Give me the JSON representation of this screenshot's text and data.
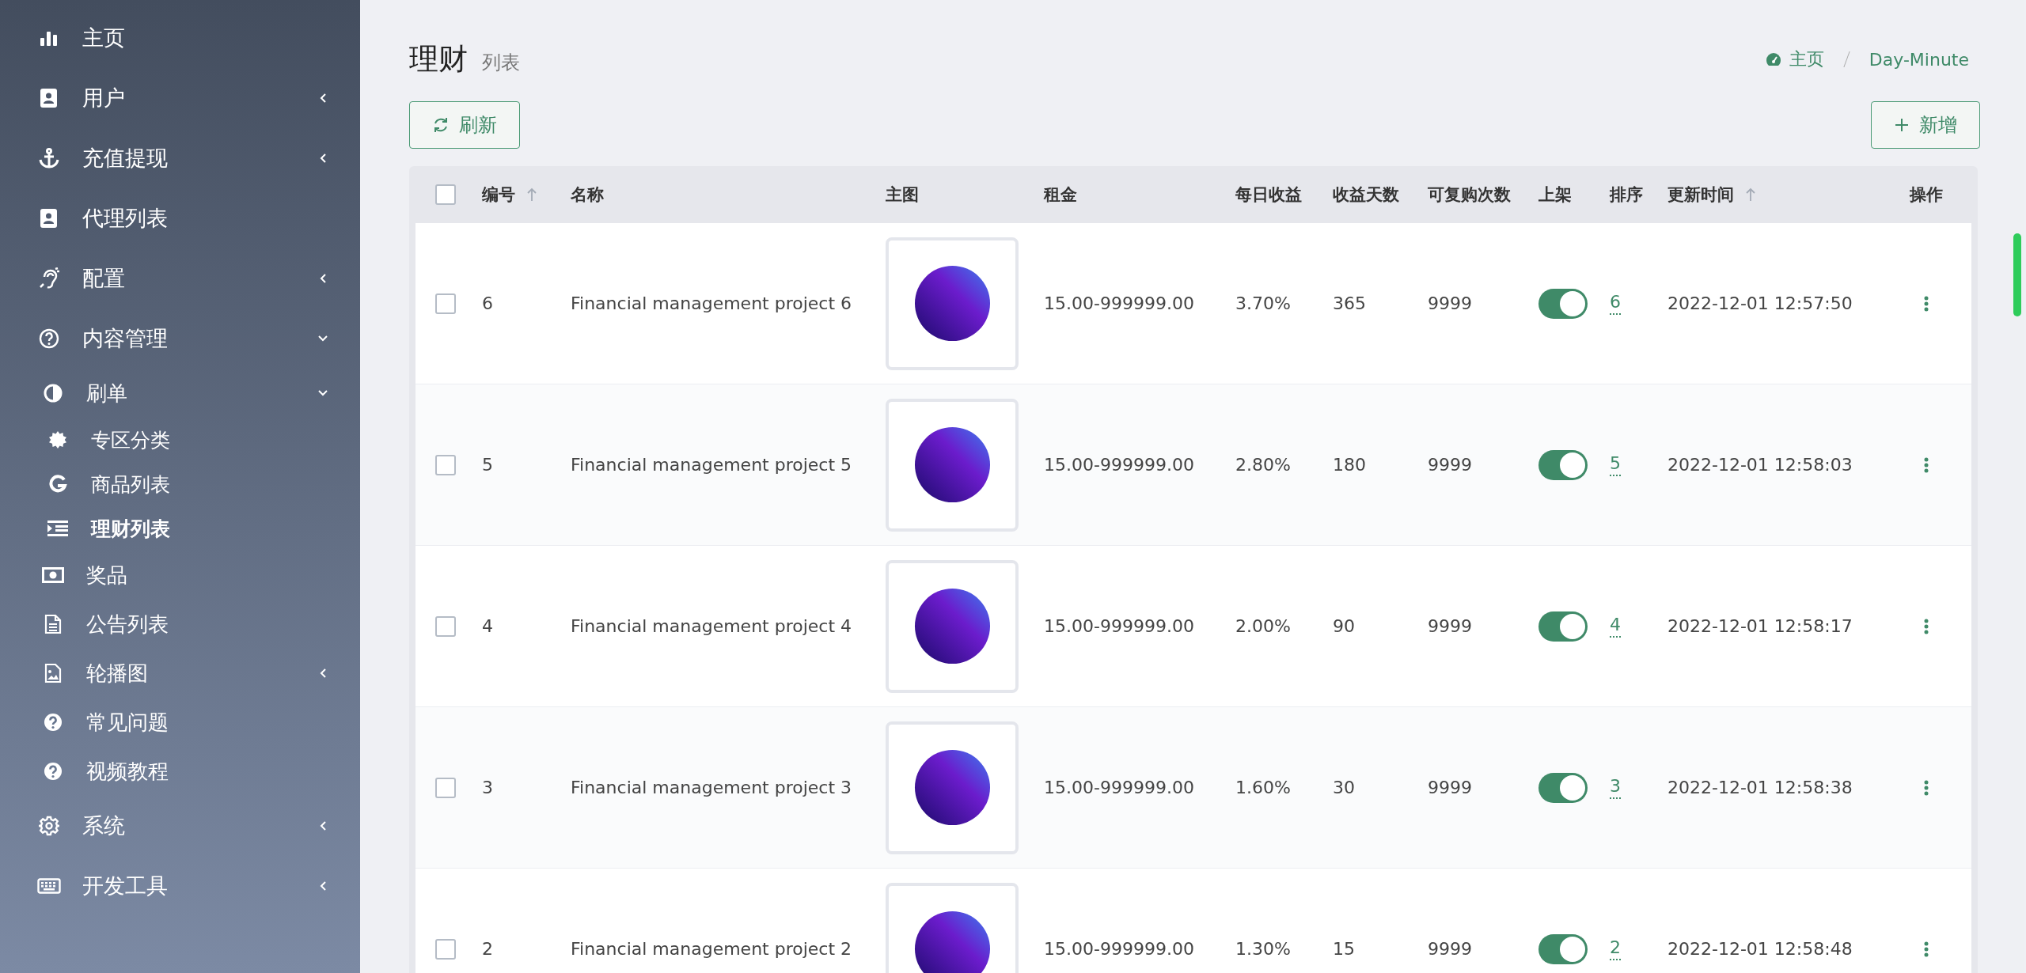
{
  "sidebar": {
    "items": [
      {
        "label": "主页",
        "selected": false
      },
      {
        "label": "用户",
        "selected": false,
        "expanded": false
      },
      {
        "label": "充值提现",
        "selected": false,
        "expanded": false
      },
      {
        "label": "代理列表",
        "selected": false
      },
      {
        "label": "配置",
        "selected": false,
        "expanded": false
      },
      {
        "label": "内容管理",
        "selected": false,
        "expanded": true,
        "children": [
          {
            "label": "刷单",
            "selected": false,
            "expanded": true,
            "children": [
              {
                "label": "专区分类",
                "selected": false
              },
              {
                "label": "商品列表",
                "selected": false
              },
              {
                "label": "理财列表",
                "selected": true
              }
            ]
          },
          {
            "label": "奖品",
            "selected": false
          },
          {
            "label": "公告列表",
            "selected": false
          },
          {
            "label": "轮播图",
            "selected": false,
            "expanded": false
          },
          {
            "label": "常见问题",
            "selected": false
          },
          {
            "label": "视频教程",
            "selected": false
          }
        ]
      },
      {
        "label": "系统",
        "selected": false,
        "expanded": false
      },
      {
        "label": "开发工具",
        "selected": false,
        "expanded": false
      }
    ]
  },
  "page": {
    "title": "理财",
    "subtitle": "列表",
    "breadcrumb": [
      "主页",
      "Day-Minute"
    ]
  },
  "toolbar": {
    "refresh": "刷新",
    "add": "新增"
  },
  "table": {
    "select_all_checked": false,
    "columns": [
      {
        "label": "编号",
        "sortable": true
      },
      {
        "label": "名称",
        "sortable": false
      },
      {
        "label": "主图",
        "sortable": false
      },
      {
        "label": "租金",
        "sortable": false
      },
      {
        "label": "每日收益",
        "sortable": false
      },
      {
        "label": "收益天数",
        "sortable": false
      },
      {
        "label": "可复购次数",
        "sortable": false
      },
      {
        "label": "上架",
        "sortable": false
      },
      {
        "label": "排序",
        "sortable": false
      },
      {
        "label": "更新时间",
        "sortable": true
      },
      {
        "label": "操作",
        "sortable": false
      }
    ],
    "rows": [
      {
        "checked": false,
        "id": "6",
        "name": "Financial management project 6",
        "rent": "15.00-999999.00",
        "daily": "3.70%",
        "days": "365",
        "repurchase": "9999",
        "on": true,
        "sort": "6",
        "updated": "2022-12-01 12:57:50"
      },
      {
        "checked": false,
        "id": "5",
        "name": "Financial management project 5",
        "rent": "15.00-999999.00",
        "daily": "2.80%",
        "days": "180",
        "repurchase": "9999",
        "on": true,
        "sort": "5",
        "updated": "2022-12-01 12:58:03"
      },
      {
        "checked": false,
        "id": "4",
        "name": "Financial management project 4",
        "rent": "15.00-999999.00",
        "daily": "2.00%",
        "days": "90",
        "repurchase": "9999",
        "on": true,
        "sort": "4",
        "updated": "2022-12-01 12:58:17"
      },
      {
        "checked": false,
        "id": "3",
        "name": "Financial management project 3",
        "rent": "15.00-999999.00",
        "daily": "1.60%",
        "days": "30",
        "repurchase": "9999",
        "on": true,
        "sort": "3",
        "updated": "2022-12-01 12:58:38"
      },
      {
        "checked": false,
        "id": "2",
        "name": "Financial management project 2",
        "rent": "15.00-999999.00",
        "daily": "1.30%",
        "days": "15",
        "repurchase": "9999",
        "on": true,
        "sort": "2",
        "updated": "2022-12-01 12:58:48"
      }
    ]
  }
}
